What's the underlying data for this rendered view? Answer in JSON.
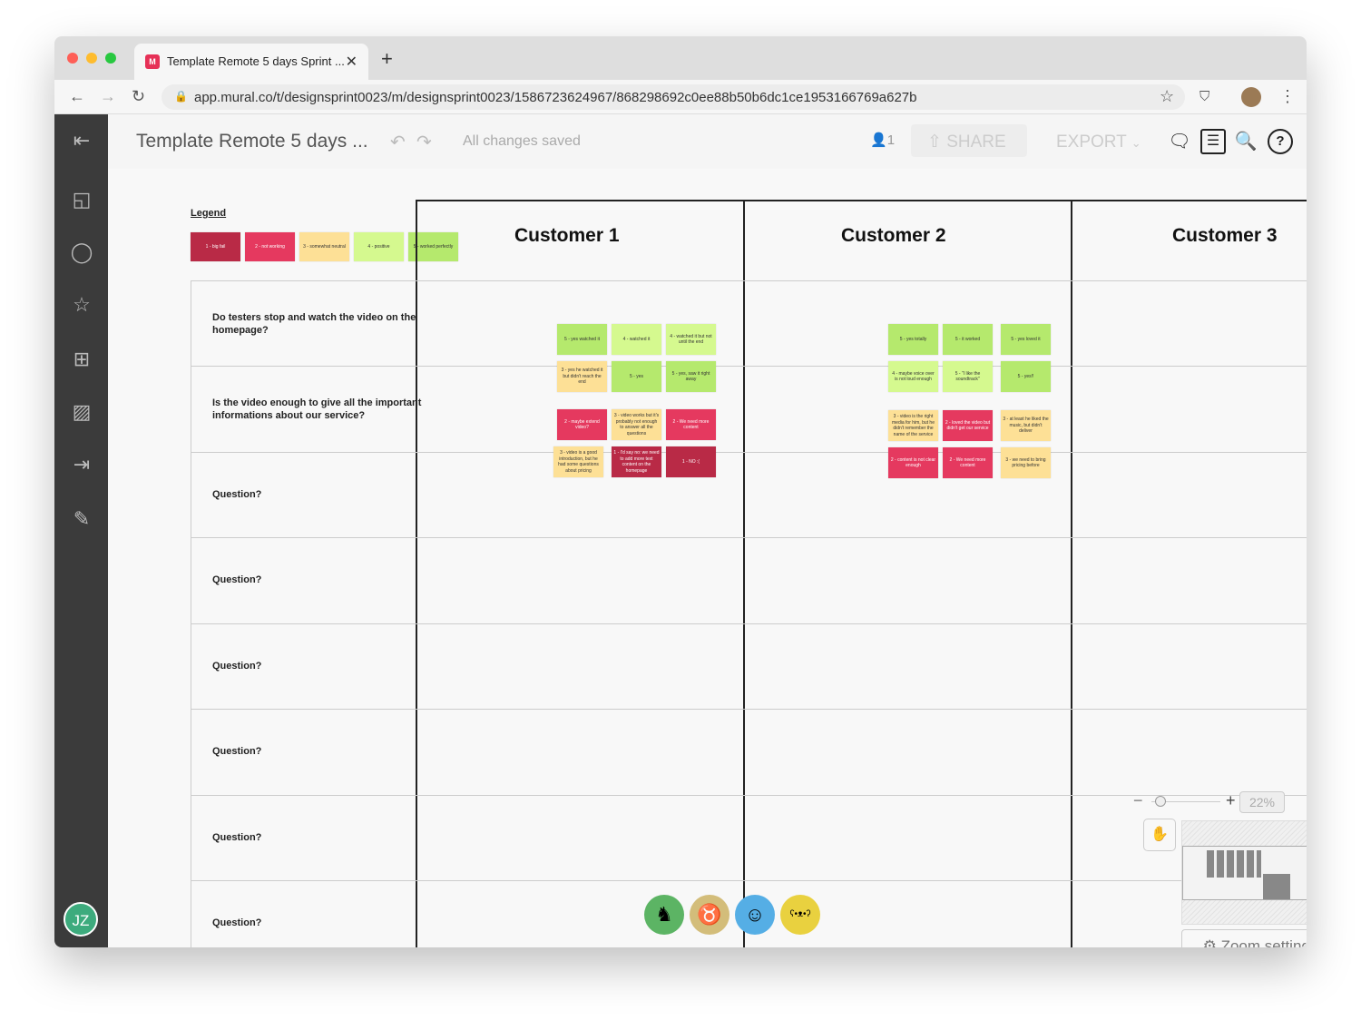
{
  "browser": {
    "tab_title": "Template Remote 5 days Sprint ...",
    "favicon": "M",
    "url": "app.mural.co/t/designsprint0023/m/designsprint0023/1586723624967/868298692c0ee88b50b6dc1ce1953166769a627b"
  },
  "toolbar": {
    "title": "Template Remote 5 days ...",
    "status": "All changes saved",
    "users_count": "1",
    "share": "SHARE",
    "export": "EXPORT"
  },
  "user": {
    "initials": "JZ"
  },
  "legend": {
    "title": "Legend",
    "items": [
      {
        "label": "1 - big fail",
        "color": "#b92a46",
        "text": "#fff"
      },
      {
        "label": "2 - not working",
        "color": "#e5395f",
        "text": "#fff"
      },
      {
        "label": "3 - somewhat neutral",
        "color": "#fde096",
        "text": "#333"
      },
      {
        "label": "4 - positive",
        "color": "#d5f98f",
        "text": "#333"
      },
      {
        "label": "5 - worked perfectly",
        "color": "#b5e96d",
        "text": "#333"
      }
    ]
  },
  "columns": [
    "Customer 1",
    "Customer 2",
    "Customer 3"
  ],
  "questions": [
    "Do testers stop and watch the video on the homepage?",
    "Is the video enough to give all the important informations about our service?",
    "Question?",
    "Question?",
    "Question?",
    "Question?",
    "Question?",
    "Question?"
  ],
  "stickies": {
    "customer1": [
      {
        "text": "5 - yes watched it",
        "score": 5
      },
      {
        "text": "4 - watched it",
        "score": 4
      },
      {
        "text": "4 - watched it but not until the end",
        "score": 4
      },
      {
        "text": "3 - yes he watched it but didn't reach the end",
        "score": 3
      },
      {
        "text": "5 - yes",
        "score": 5
      },
      {
        "text": "5 - yes, saw it right away",
        "score": 5
      },
      {
        "text": "2 - maybe extend video?",
        "score": 2
      },
      {
        "text": "3 - video works but it's probably not enough to answer all the questions",
        "score": 3
      },
      {
        "text": "2 - We need more content",
        "score": 2
      },
      {
        "text": "3 - video is a good introduction, but he had some questions about pricing",
        "score": 3
      },
      {
        "text": "1 - I'd say no: we need to add more text content on the homepage",
        "score": 1
      },
      {
        "text": "1 - NO :(",
        "score": 1
      }
    ],
    "customer2": [
      {
        "text": "5 - yes totally",
        "score": 5
      },
      {
        "text": "5 - it worked",
        "score": 5
      },
      {
        "text": "5 - yes loved it",
        "score": 5
      },
      {
        "text": "4 - maybe voice over is not loud enough",
        "score": 4
      },
      {
        "text": "5 - \"I like the soundtrack\"",
        "score": 4
      },
      {
        "text": "5 - yes!!",
        "score": 5
      },
      {
        "text": "3 - video is the right media for him, but he didn't remember the name of the service",
        "score": 3
      },
      {
        "text": "2 - loved the video but didn't get our service",
        "score": 2
      },
      {
        "text": "3 - at least he liked the music, but didn't deliver",
        "score": 3
      },
      {
        "text": "2 - content is not clear enough",
        "score": 2
      },
      {
        "text": "2 - We need more content",
        "score": 2
      },
      {
        "text": "3 - we need to bring pricing before",
        "score": 3
      }
    ]
  },
  "collaborators": [
    {
      "name": "seahorse",
      "color": "#5cb464"
    },
    {
      "name": "giraffe",
      "color": "#d3bd7a"
    },
    {
      "name": "sheep",
      "color": "#55aee5"
    },
    {
      "name": "bear",
      "color": "#e9d13f"
    }
  ],
  "zoom": {
    "level": "22%",
    "settings": "Zoom settings",
    "slider": 0.22
  }
}
